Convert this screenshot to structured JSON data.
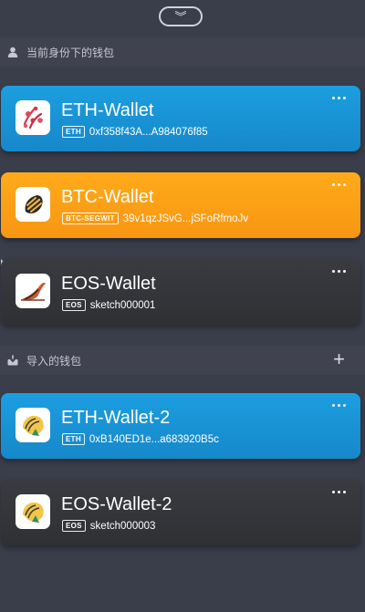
{
  "top": {
    "collapse_icon": "double-chevron-down-icon",
    "collapse_glyph": "︾"
  },
  "section_current": {
    "label": "当前身份下的钱包",
    "icon": "person-icon"
  },
  "section_imported": {
    "label": "导入的钱包",
    "icon": "import-icon",
    "add_glyph": "+"
  },
  "wallets": [
    {
      "name": "ETH-Wallet",
      "badge": "ETH",
      "address": "0xf358f43A...A984076f85",
      "color": "#1c9ee0"
    },
    {
      "name": "BTC-Wallet",
      "badge": "BTC-SEGWIT",
      "address": "39v1qzJSvG...jSFoRfmoJv",
      "color": "#ffaa1b"
    },
    {
      "name": "EOS-Wallet",
      "badge": "EOS",
      "address": "sketch000001",
      "color": "#3a3b40"
    }
  ],
  "imported_wallets": [
    {
      "name": "ETH-Wallet-2",
      "badge": "ETH",
      "address": "0xB140ED1e...a683920B5c",
      "color": "#1c9ee0"
    },
    {
      "name": "EOS-Wallet-2",
      "badge": "EOS",
      "address": "sketch000003",
      "color": "#3a3b40"
    }
  ]
}
